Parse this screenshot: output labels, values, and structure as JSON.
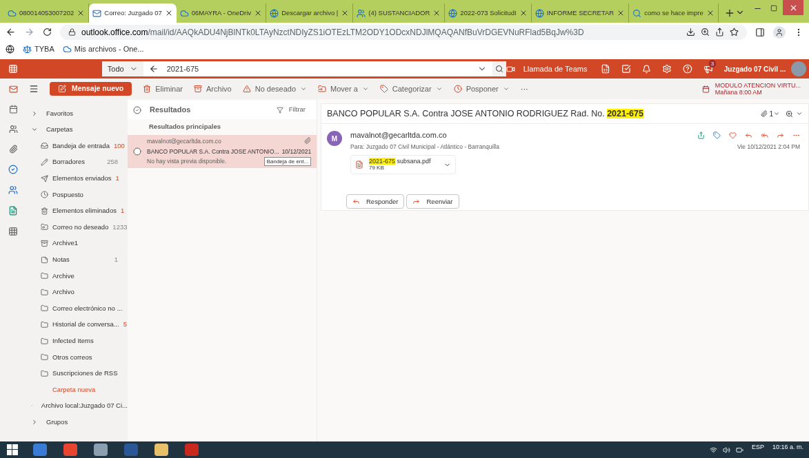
{
  "browser": {
    "tabs": [
      {
        "title": "080014053007202",
        "kind": "cloud",
        "selected": false
      },
      {
        "title": "Correo: Juzgado 07",
        "kind": "mail",
        "selected": true
      },
      {
        "title": "06MAYRA - OneDriv",
        "kind": "cloud",
        "selected": false
      },
      {
        "title": "Descargar archivo |",
        "kind": "globe",
        "selected": false
      },
      {
        "title": "(4) SUSTANCIADOR",
        "kind": "team",
        "selected": false
      },
      {
        "title": "2022-073 SolicitudI",
        "kind": "globe",
        "selected": false
      },
      {
        "title": "INFORME SECRETAR",
        "kind": "globe",
        "selected": false
      },
      {
        "title": "como se hace impre",
        "kind": "search",
        "selected": false
      }
    ],
    "url_host": "outlook.office.com",
    "url_path": "/mail/id/AAQkADU4NjBlNTk0LTAyNzctNDIyZS1iOTEzLTM2ODY1ODcxNDJlMQAQANfBuVrDGEVNuRFlad5BqJw%3D",
    "bookmarks": [
      {
        "label": "TYBA",
        "kind": "scale"
      },
      {
        "label": "Mis archivos - One...",
        "kind": "cloud"
      }
    ]
  },
  "header": {
    "scope": "Todo",
    "query": "2021-675",
    "teams_call": "Llamada de Teams",
    "notification_count": "3",
    "account": "Juzgado 07 Civil ..."
  },
  "toolbar": {
    "new_message": "Mensaje nuevo",
    "actions": [
      {
        "label": "Eliminar",
        "kind": "trash",
        "menu": false
      },
      {
        "label": "Archivo",
        "kind": "archive",
        "menu": false
      },
      {
        "label": "No deseado",
        "kind": "warning",
        "menu": true
      },
      {
        "label": "Mover a",
        "kind": "move",
        "menu": true
      },
      {
        "label": "Categorizar",
        "kind": "tag",
        "menu": true
      },
      {
        "label": "Posponer",
        "kind": "clock",
        "menu": true
      }
    ],
    "more": "···",
    "reminder": {
      "title": "MODULO ATENCION VIRTU...",
      "time": "Mañana 8:00 AM"
    }
  },
  "folders": {
    "groups": [
      {
        "label": "Favoritos",
        "expanded": false
      },
      {
        "label": "Carpetas",
        "expanded": true,
        "children": [
          {
            "label": "Bandeja de entrada",
            "kind": "inbox",
            "count": "100",
            "unread": true
          },
          {
            "label": "Borradores",
            "kind": "draft",
            "count": "258",
            "unread": false
          },
          {
            "label": "Elementos enviados",
            "kind": "send",
            "count": "1",
            "unread": true
          },
          {
            "label": "Pospuesto",
            "kind": "clock"
          },
          {
            "label": "Elementos eliminados",
            "kind": "trash",
            "count": "1",
            "unread": true
          },
          {
            "label": "Correo no deseado",
            "kind": "move",
            "count": "1233",
            "unread": false
          },
          {
            "label": "Archive1",
            "kind": "archive"
          },
          {
            "label": "Notas",
            "kind": "note",
            "count": "1",
            "unread": false
          },
          {
            "label": "Archive",
            "kind": "folder"
          },
          {
            "label": "Archivo",
            "kind": "folder"
          },
          {
            "label": "Correo electrónico no ...",
            "kind": "folder"
          },
          {
            "label": "Historial de conversa...",
            "kind": "folder",
            "count": "5",
            "unread": true
          },
          {
            "label": "Infected Items",
            "kind": "folder"
          },
          {
            "label": "Otros correos",
            "kind": "folder"
          },
          {
            "label": "Suscripciones de RSS",
            "kind": "folder"
          },
          {
            "label": "Carpeta nueva",
            "kind": "link"
          }
        ]
      },
      {
        "label": "Archivo local:Juzgado 07 Ci...",
        "expanded": false
      },
      {
        "label": "Grupos",
        "expanded": false
      }
    ]
  },
  "message_list": {
    "title": "Resultados",
    "filter": "Filtrar",
    "section": "Resultados principales",
    "messages": [
      {
        "sender": "mavalnot@gecarltda.com.co",
        "subject": "BANCO POPULAR S.A. Contra JOSE ANTONIO...",
        "date": "10/12/2021",
        "preview": "No hay vista previa disponible.",
        "folder": "Bandeja de ent...",
        "selected": true
      }
    ]
  },
  "reading": {
    "subject": "BANCO POPULAR S.A. Contra JOSE ANTONIO RODRIGUEZ Rad. No.",
    "subject_highlight": "2021-675",
    "attachment_count": "1",
    "avatar_letter": "M",
    "sender": "mavalnot@gecarltda.com.co",
    "to_label": "Para:",
    "to": "Juzgado 07 Civil Municipal - Atlántico - Barranquilla",
    "date": "Vie 10/12/2021 2:04 PM",
    "attachment": {
      "highlight": "2021-675",
      "rest": " subsana.pdf",
      "size": "79 KB"
    },
    "buttons": [
      {
        "label": "Responder",
        "kind": "reply"
      },
      {
        "label": "Reenviar",
        "kind": "forward"
      }
    ]
  },
  "taskbar": {
    "language": "ESP",
    "time": "10:16 a. m."
  }
}
